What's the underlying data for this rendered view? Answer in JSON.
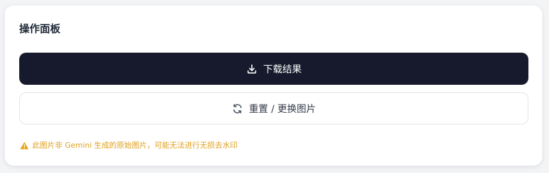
{
  "panel": {
    "title": "操作面板"
  },
  "buttons": {
    "download": {
      "label": "下载结果",
      "icon": "download-icon"
    },
    "reset": {
      "label": "重置 / 更换图片",
      "icon": "refresh-icon"
    }
  },
  "warning": {
    "text": "此图片非 Gemini 生成的原始图片，可能无法进行无损去水印",
    "icon": "warning-icon"
  },
  "colors": {
    "primary_button_bg": "#161a2c",
    "primary_button_text": "#ffffff",
    "warning_text": "#e0a020",
    "warning_icon": "#e8a317"
  }
}
